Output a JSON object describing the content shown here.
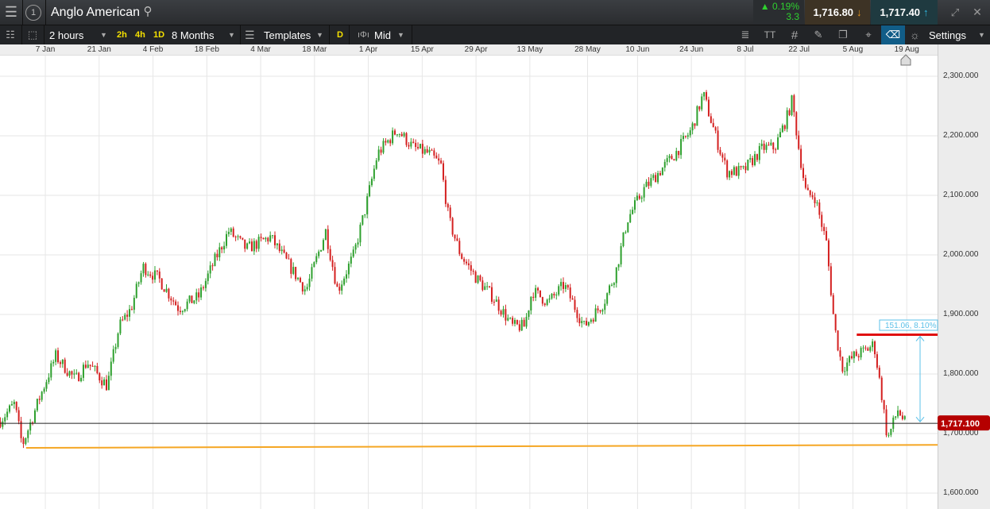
{
  "header": {
    "menu_icon": "hamburger-icon",
    "workspace": "1",
    "instrument": "Anglo American",
    "change_pct": "0.19%",
    "change_abs": "3.3",
    "sell": "1,716.80",
    "buy": "1,717.40"
  },
  "toolbar": {
    "interval": "2 hours",
    "q1": "2h",
    "q2": "4h",
    "q3": "1D",
    "range": "8 Months",
    "templates": "Templates",
    "d": "D",
    "price_type": "Mid",
    "settings": "Settings"
  },
  "colors": {
    "up": "#2ea02e",
    "down": "#d42020",
    "support": "#f5a623",
    "resistance": "#e01010",
    "measure": "#5bc0e8",
    "price_tag": "#b50000"
  },
  "chart_data": {
    "type": "candlestick",
    "title": "Anglo American",
    "x_ticks": [
      {
        "label": "7 Jan",
        "day": 6
      },
      {
        "label": "21 Jan",
        "day": 20
      },
      {
        "label": "4 Feb",
        "day": 34
      },
      {
        "label": "18 Feb",
        "day": 48
      },
      {
        "label": "4 Mar",
        "day": 62
      },
      {
        "label": "18 Mar",
        "day": 76
      },
      {
        "label": "1 Apr",
        "day": 90
      },
      {
        "label": "15 Apr",
        "day": 104
      },
      {
        "label": "29 Apr",
        "day": 118
      },
      {
        "label": "13 May",
        "day": 132
      },
      {
        "label": "28 May",
        "day": 147
      },
      {
        "label": "10 Jun",
        "day": 160
      },
      {
        "label": "24 Jun",
        "day": 174
      },
      {
        "label": "8 Jul",
        "day": 188
      },
      {
        "label": "22 Jul",
        "day": 202
      },
      {
        "label": "5 Aug",
        "day": 216
      },
      {
        "label": "19 Aug",
        "day": 230
      }
    ],
    "y_ticks": [
      "2,300.000",
      "2,200.000",
      "2,100.000",
      "2,000.000",
      "1,900.000",
      "1,800.000",
      "1,700.000",
      "1,600.000"
    ],
    "y_tick_values": [
      2300,
      2200,
      2100,
      2000,
      1900,
      1800,
      1700,
      1600
    ],
    "ylim": [
      1572,
      2360
    ],
    "xlim_days": [
      -6,
      237
    ],
    "approx_path": [
      [
        -6,
        1720
      ],
      [
        -2,
        1750
      ],
      [
        0,
        1680
      ],
      [
        4.5,
        1760
      ],
      [
        8.7,
        1830
      ],
      [
        13.8,
        1790
      ],
      [
        16.9,
        1820
      ],
      [
        22.1,
        1780
      ],
      [
        25.2,
        1880
      ],
      [
        28.3,
        1910
      ],
      [
        31.4,
        1980
      ],
      [
        35.5,
        1960
      ],
      [
        40.7,
        1910
      ],
      [
        45.9,
        1930
      ],
      [
        50,
        1990
      ],
      [
        53.7,
        2040
      ],
      [
        58.3,
        2010
      ],
      [
        64.5,
        2030
      ],
      [
        68.6,
        1990
      ],
      [
        73.8,
        1940
      ],
      [
        78.9,
        2040
      ],
      [
        82,
        1940
      ],
      [
        86.2,
        2000
      ],
      [
        89.3,
        2080
      ],
      [
        92.4,
        2170
      ],
      [
        97.5,
        2210
      ],
      [
        101.7,
        2180
      ],
      [
        105.8,
        2170
      ],
      [
        108.9,
        2150
      ],
      [
        110.9,
        2060
      ],
      [
        114,
        2000
      ],
      [
        118.2,
        1960
      ],
      [
        122.3,
        1930
      ],
      [
        127.5,
        1880
      ],
      [
        130.6,
        1880
      ],
      [
        132.6,
        1940
      ],
      [
        136.8,
        1920
      ],
      [
        140.9,
        1950
      ],
      [
        146.1,
        1880
      ],
      [
        151.2,
        1920
      ],
      [
        154.3,
        1970
      ],
      [
        157.4,
        2060
      ],
      [
        161.6,
        2110
      ],
      [
        165.7,
        2140
      ],
      [
        169.8,
        2170
      ],
      [
        174,
        2210
      ],
      [
        177.1,
        2270
      ],
      [
        181.2,
        2180
      ],
      [
        183.3,
        2140
      ],
      [
        187.4,
        2140
      ],
      [
        192.6,
        2180
      ],
      [
        195.7,
        2180
      ],
      [
        198.8,
        2230
      ],
      [
        200.2,
        2260
      ],
      [
        201.9,
        2180
      ],
      [
        203.9,
        2100
      ],
      [
        206,
        2100
      ],
      [
        209.1,
        2020
      ],
      [
        211.2,
        1880
      ],
      [
        213.2,
        1810
      ],
      [
        216.3,
        1830
      ],
      [
        219.4,
        1840
      ],
      [
        221.5,
        1850
      ],
      [
        223.6,
        1760
      ],
      [
        225,
        1690
      ],
      [
        227.7,
        1740
      ],
      [
        229.8,
        1715
      ]
    ],
    "current_price": 1717.1,
    "current_price_label": "1,717.100",
    "support_line": {
      "from": [
        1,
        1676
      ],
      "to": [
        237,
        1681
      ]
    },
    "resistance_line": {
      "from": [
        217,
        1866
      ],
      "to": [
        237,
        1866
      ]
    },
    "measure": {
      "label": "151.06, 8.10%,",
      "from": 1866,
      "to": 1717.1
    }
  }
}
